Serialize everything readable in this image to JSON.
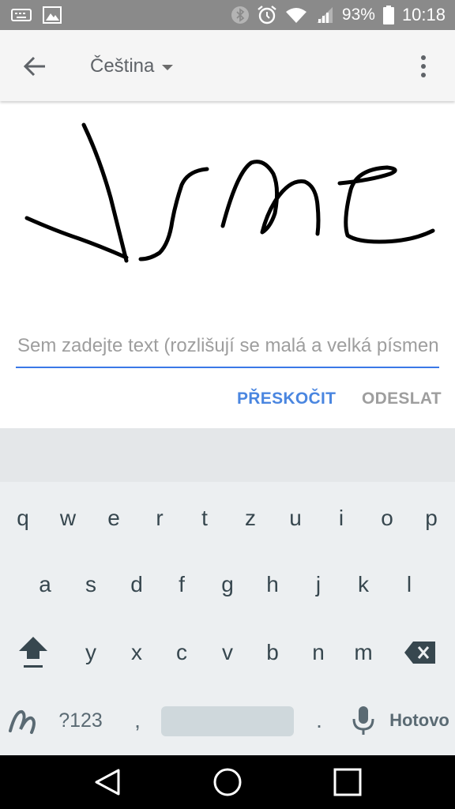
{
  "status_bar": {
    "battery": "93%",
    "time": "10:18",
    "icons": [
      "keyboard-icon",
      "image-icon",
      "bluetooth-icon",
      "alarm-icon",
      "wifi-icon",
      "signal-icon",
      "battery-icon"
    ]
  },
  "app_bar": {
    "language": "Čeština",
    "icons": [
      "back-arrow-icon",
      "dropdown-caret-icon",
      "more-vert-icon"
    ]
  },
  "handwriting": {
    "stroke_color": "#000000"
  },
  "input": {
    "placeholder": "Sem zadejte text (rozlišují se malá a velká písmena)",
    "value": ""
  },
  "actions": {
    "skip_label": "PŘESKOČIT",
    "send_label": "ODESLAT"
  },
  "keyboard": {
    "row1": [
      "q",
      "w",
      "e",
      "r",
      "t",
      "z",
      "u",
      "i",
      "o",
      "p"
    ],
    "row2": [
      "a",
      "s",
      "d",
      "f",
      "g",
      "h",
      "j",
      "k",
      "l"
    ],
    "row3": [
      "y",
      "x",
      "c",
      "v",
      "b",
      "n",
      "m"
    ],
    "symbols_label": "?123",
    "comma": ",",
    "period": ".",
    "done_label": "Hotovo"
  },
  "colors": {
    "accent": "#3b78e7",
    "status_bar": "#8a8a8a",
    "keyboard_bg": "#eceff1"
  }
}
